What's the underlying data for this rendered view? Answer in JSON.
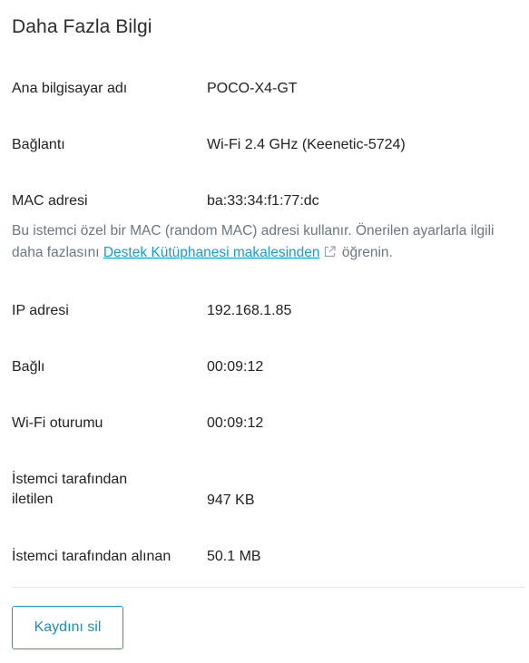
{
  "title": "Daha Fazla Bilgi",
  "rows": {
    "hostname": {
      "label": "Ana bilgisayar adı",
      "value": "POCO-X4-GT"
    },
    "connection": {
      "label": "Bağlantı",
      "value": "Wi-Fi 2.4 GHz (Keenetic-5724)"
    },
    "mac": {
      "label": "MAC adresi",
      "value": "ba:33:34:f1:77:dc"
    },
    "ip": {
      "label": "IP adresi",
      "value": "192.168.1.85"
    },
    "connected": {
      "label": "Bağlı",
      "value": "00:09:12"
    },
    "wifi_session": {
      "label": "Wi-Fi oturumu",
      "value": "00:09:12"
    },
    "sent": {
      "label": "İstemci tarafından iletilen",
      "value": "947 KB"
    },
    "received": {
      "label": "İstemci tarafından alınan",
      "value": "50.1 MB"
    }
  },
  "mac_note": {
    "text_before": "Bu istemci özel bir MAC (random MAC) adresi kullanır. Önerilen ayarlarla ilgili daha fazlasını ",
    "link_text": "Destek Kütüphanesi makalesinden",
    "text_after": " öğrenin.",
    "link_icon": "external-link-icon"
  },
  "delete_button": {
    "label": "Kaydını sil"
  },
  "colors": {
    "accent": "#1a9cc9",
    "note_text": "#6b7683",
    "divider": "#e4e6e8"
  }
}
